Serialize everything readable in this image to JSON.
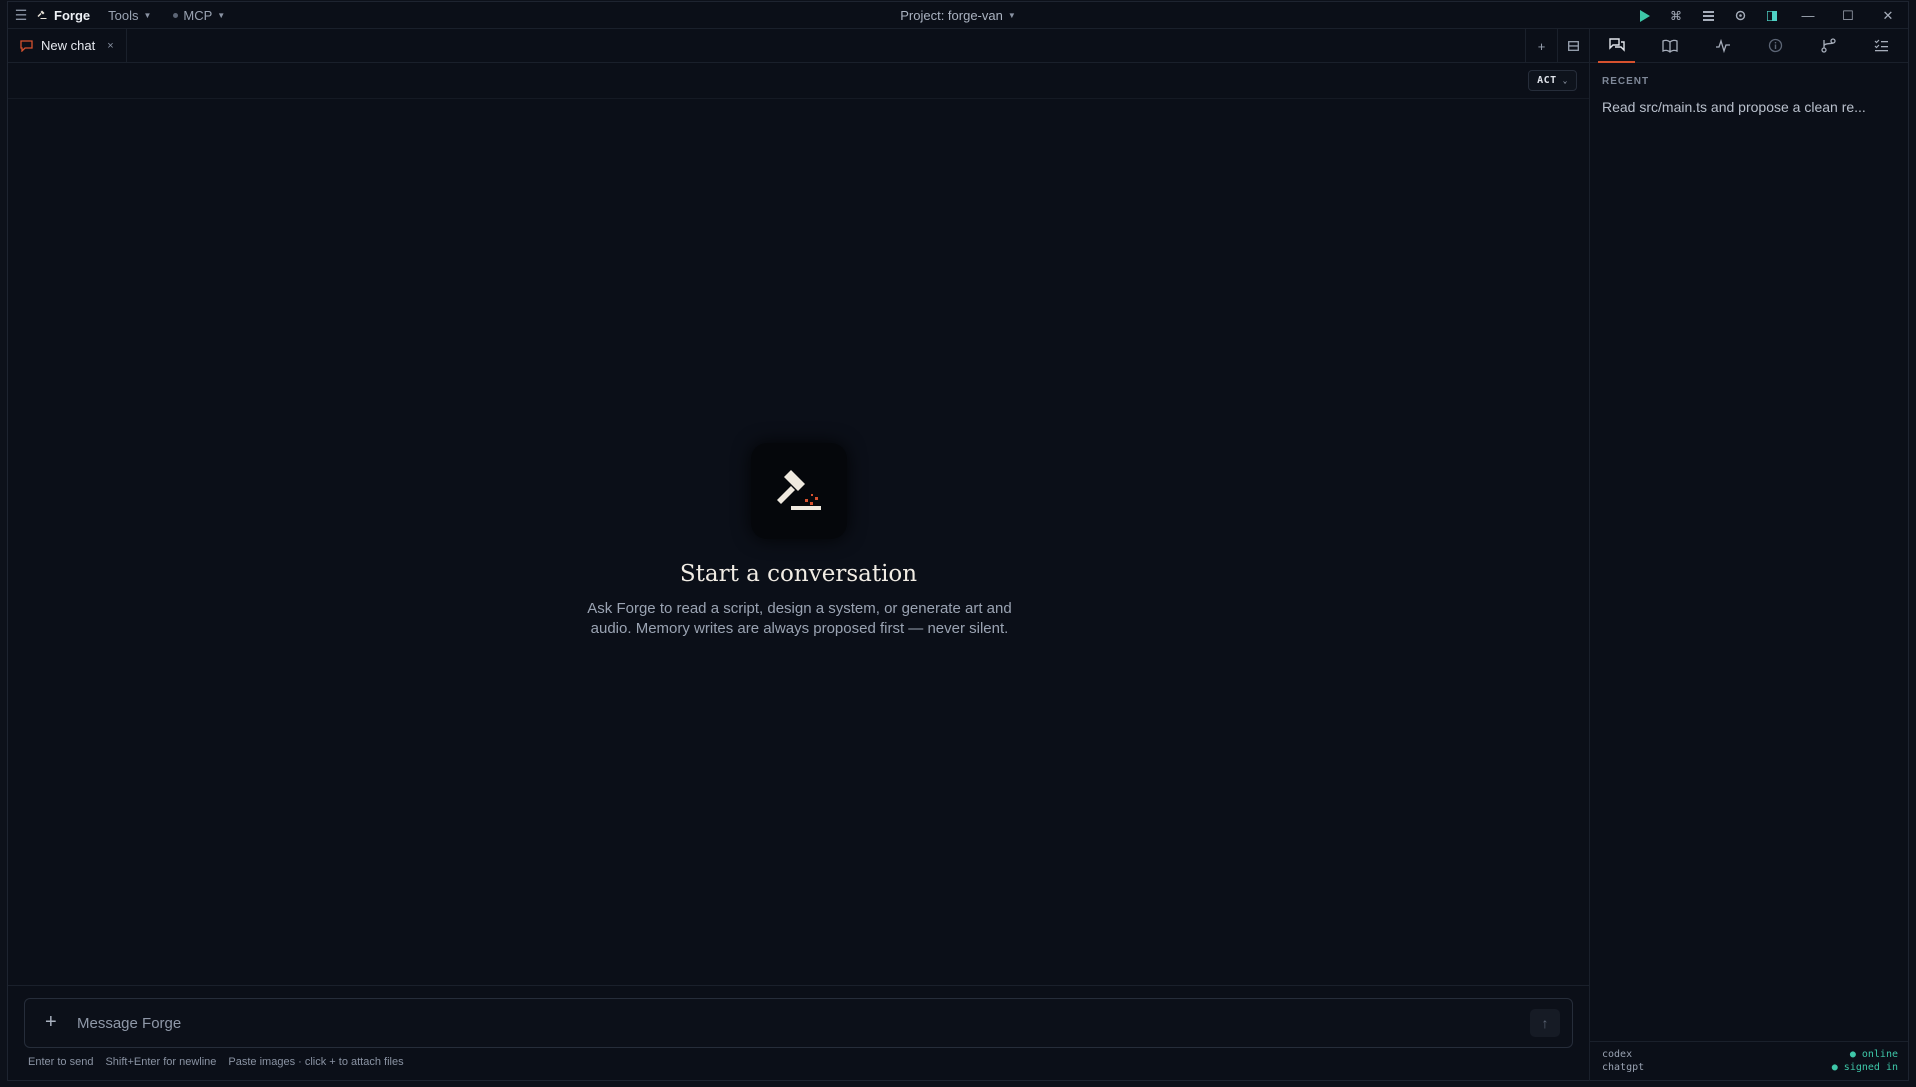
{
  "titlebar": {
    "brand": "Forge",
    "menus": [
      {
        "label": "Tools"
      },
      {
        "label": "MCP"
      }
    ],
    "project": "Project: forge-van"
  },
  "tabs": [
    {
      "label": "New chat",
      "close": "×"
    }
  ],
  "mode": {
    "label": "ACT"
  },
  "empty_state": {
    "title": "Start a conversation",
    "description": "Ask Forge to read a script, design a system, or generate art and audio. Memory writes are always proposed first — never silent."
  },
  "composer": {
    "placeholder": "Message Forge",
    "value": "",
    "hints": [
      "Enter to send",
      "Shift+Enter for newline",
      "Paste images · click + to attach files"
    ]
  },
  "side_panel": {
    "recent_label": "RECENT",
    "recent_items": [
      "Read src/main.ts and propose a clean re..."
    ],
    "providers": [
      {
        "name": "codex",
        "status": "● online"
      },
      {
        "name": "chatgpt",
        "status": "● signed in"
      }
    ]
  },
  "colors": {
    "accent": "#d6512e",
    "status_ok": "#3ec7a8",
    "background": "#0b0f18"
  }
}
